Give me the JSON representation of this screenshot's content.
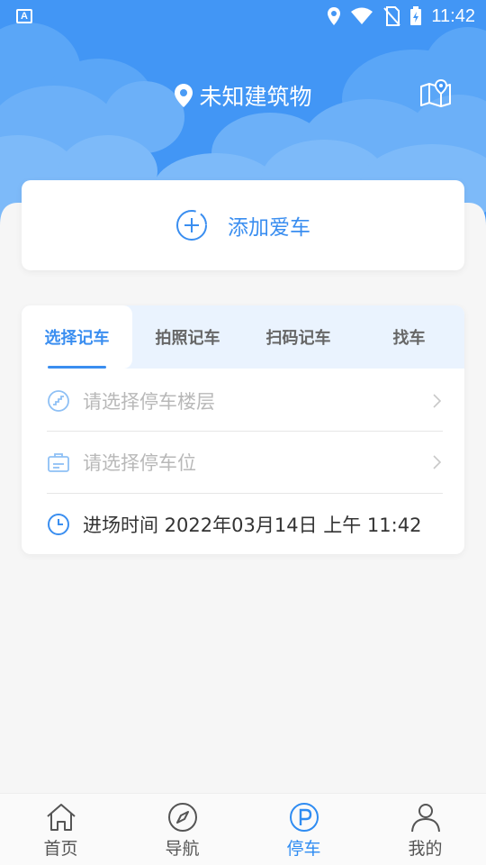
{
  "status_bar": {
    "badge": "A",
    "time": "11:42"
  },
  "header": {
    "location": "未知建筑物",
    "map_icon": "map-icon"
  },
  "add_car": {
    "label": "添加爱车"
  },
  "record_tabs": [
    {
      "label": "选择记车",
      "active": true
    },
    {
      "label": "拍照记车",
      "active": false
    },
    {
      "label": "扫码记车",
      "active": false
    },
    {
      "label": "找车",
      "active": false
    }
  ],
  "form": {
    "floor_placeholder": "请选择停车楼层",
    "spot_placeholder": "请选择停车位",
    "entry_time": "进场时间 2022年03月14日 上午 11:42"
  },
  "bottom_nav": [
    {
      "label": "首页",
      "icon": "home-icon",
      "active": false
    },
    {
      "label": "导航",
      "icon": "compass-icon",
      "active": false
    },
    {
      "label": "停车",
      "icon": "parking-icon",
      "active": true
    },
    {
      "label": "我的",
      "icon": "user-icon",
      "active": false
    }
  ],
  "colors": {
    "primary": "#3a8ef0",
    "header_bg": "#4296f5",
    "page_bg": "#f6f6f6"
  }
}
